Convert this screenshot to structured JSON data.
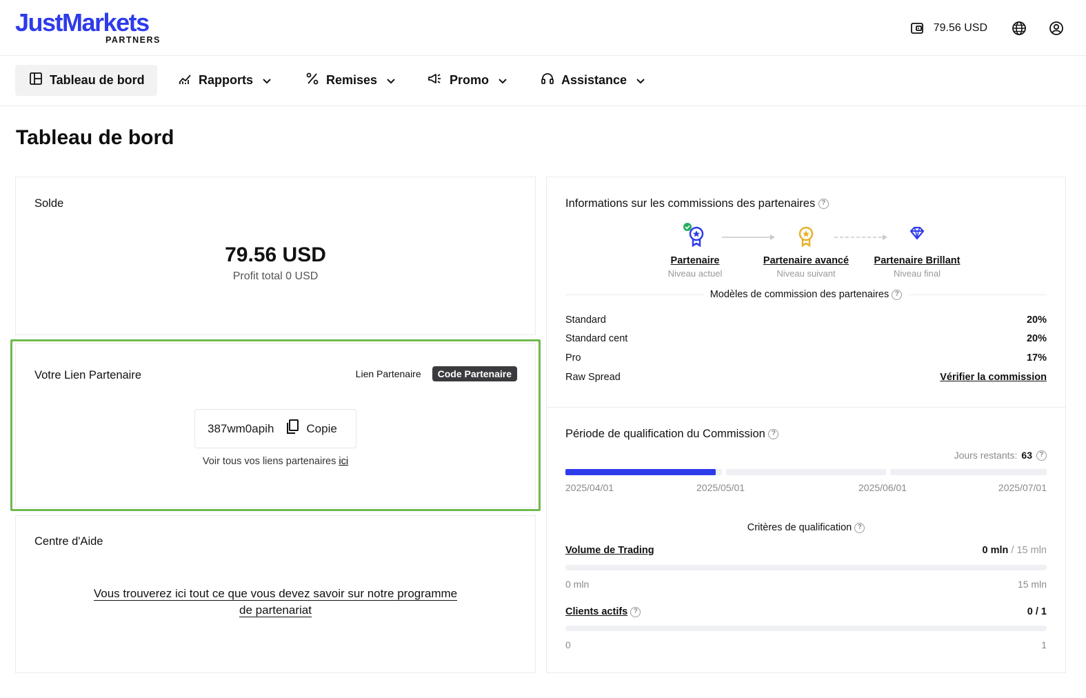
{
  "brand": {
    "name": "JustMarkets",
    "sub": "PARTNERS",
    "color": "#2e3bea"
  },
  "header": {
    "wallet_balance": "79.56 USD",
    "icons": [
      "wallet-icon",
      "globe-icon",
      "user-icon"
    ]
  },
  "nav": [
    {
      "label": "Tableau de bord",
      "icon": "dashboard-icon",
      "active": true
    },
    {
      "label": "Rapports",
      "icon": "chart-icon",
      "dropdown": true
    },
    {
      "label": "Remises",
      "icon": "percent-icon",
      "dropdown": true
    },
    {
      "label": "Promo",
      "icon": "megaphone-icon",
      "dropdown": true
    },
    {
      "label": "Assistance",
      "icon": "headset-icon",
      "dropdown": true
    }
  ],
  "page_title": "Tableau de bord",
  "balance_card": {
    "title": "Solde",
    "amount": "79.56 USD",
    "profit": "Profit total 0 USD"
  },
  "link_card": {
    "title": "Votre Lien Partenaire",
    "toggle": {
      "option_link": "Lien Partenaire",
      "option_code": "Code Partenaire",
      "selected": "Code Partenaire"
    },
    "code": "387wm0apih",
    "copy_label": "Copie",
    "see_all_text": "Voir tous vos liens partenaires",
    "see_all_link": "ici"
  },
  "help_card": {
    "title": "Centre d'Aide",
    "link_line1": "Vous trouverez ici tout ce que vous devez savoir sur notre programme",
    "link_line2": "de partenariat"
  },
  "commission_card": {
    "title": "Informations sur les commissions des partenaires",
    "levels": [
      {
        "name": "Partenaire",
        "sub": "Niveau actuel",
        "icon": "medal-blue-icon",
        "current": true
      },
      {
        "name": "Partenaire avancé",
        "sub": "Niveau suivant",
        "icon": "medal-gold-icon"
      },
      {
        "name": "Partenaire Brillant",
        "sub": "Niveau final",
        "icon": "diamond-icon"
      }
    ],
    "models_title": "Modèles de commission des partenaires",
    "models": [
      {
        "name": "Standard",
        "value": "20%"
      },
      {
        "name": "Standard cent",
        "value": "20%"
      },
      {
        "name": "Pro",
        "value": "17%"
      },
      {
        "name": "Raw Spread",
        "value": "Vérifier la commission"
      }
    ]
  },
  "qualification_card": {
    "title": "Période de qualification du Commission",
    "days_left_label": "Jours restants:",
    "days_left_value": "63",
    "period_progress_fraction": 0.31,
    "dates": [
      "2025/04/01",
      "2025/05/01",
      "2025/06/01",
      "2025/07/01"
    ],
    "criteria_title": "Critères de qualification",
    "criteria": [
      {
        "label": "Volume de Trading",
        "value": "0 mln",
        "max": "/ 15 mln",
        "min_label": "0 mln",
        "max_label": "15 mln",
        "progress": 0,
        "help": false
      },
      {
        "label": "Clients actifs",
        "value": "0 / 1",
        "max": "",
        "min_label": "0",
        "max_label": "1",
        "progress": 0,
        "help": true
      }
    ]
  }
}
